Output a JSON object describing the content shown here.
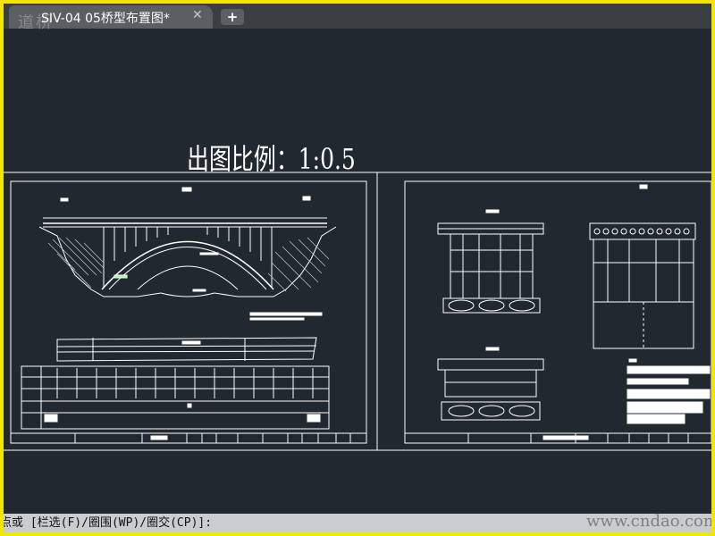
{
  "app": {
    "watermark_logo": "道桥",
    "site_watermark": "www.cndao.com"
  },
  "tabs": [
    {
      "title": "SIV-04  05桥型布置图*",
      "close_glyph": "✕",
      "active": true
    }
  ],
  "new_tab_glyph": "+",
  "drawing": {
    "scale_label": "出图比例：1:0.5",
    "background": "#212830",
    "line_color": "#ffffff"
  },
  "command_line": {
    "prompt": "点或 [栏选(F)/圈围(WP)/圈交(CP)]:"
  },
  "colors": {
    "outer_border": "#f2e600",
    "tabbar": "#3a3f44",
    "tab_active": "#5a5f63",
    "command_bg": "#c9cdd0"
  }
}
